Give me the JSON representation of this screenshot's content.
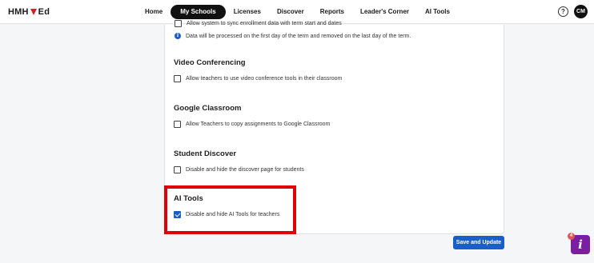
{
  "brand": {
    "text_a": "HMH",
    "text_b": "Ed"
  },
  "nav": {
    "items": [
      {
        "label": "Home",
        "active": false
      },
      {
        "label": "My Schools",
        "active": true
      },
      {
        "label": "Licenses",
        "active": false
      },
      {
        "label": "Discover",
        "active": false
      },
      {
        "label": "Reports",
        "active": false
      },
      {
        "label": "Leader's Corner",
        "active": false
      },
      {
        "label": "AI Tools",
        "active": false
      }
    ],
    "help_glyph": "?",
    "avatar_initials": "CM"
  },
  "settings": {
    "partial_option": "Allow system to sync enrollment data with term start and dates",
    "info_note": "Data will be processed on the first day of the term and removed on the last day of the term.",
    "sections": [
      {
        "title": "Video Conferencing",
        "option": "Allow teachers to use video conference tools in their classroom",
        "checked": false
      },
      {
        "title": "Google Classroom",
        "option": "Allow Teachers to copy assignments to Google Classroom",
        "checked": false
      },
      {
        "title": "Student Discover",
        "option": "Disable and hide the discover page for students",
        "checked": false
      },
      {
        "title": "AI Tools",
        "option": "Disable and hide AI Tools for teachers",
        "checked": true
      }
    ]
  },
  "actions": {
    "save_label": "Save and Update"
  },
  "assistant": {
    "badge_count": "4",
    "glyph": "i"
  },
  "colors": {
    "accent": "#1a5fc8",
    "highlight": "#e10000",
    "assistant": "#7a1fa2"
  }
}
